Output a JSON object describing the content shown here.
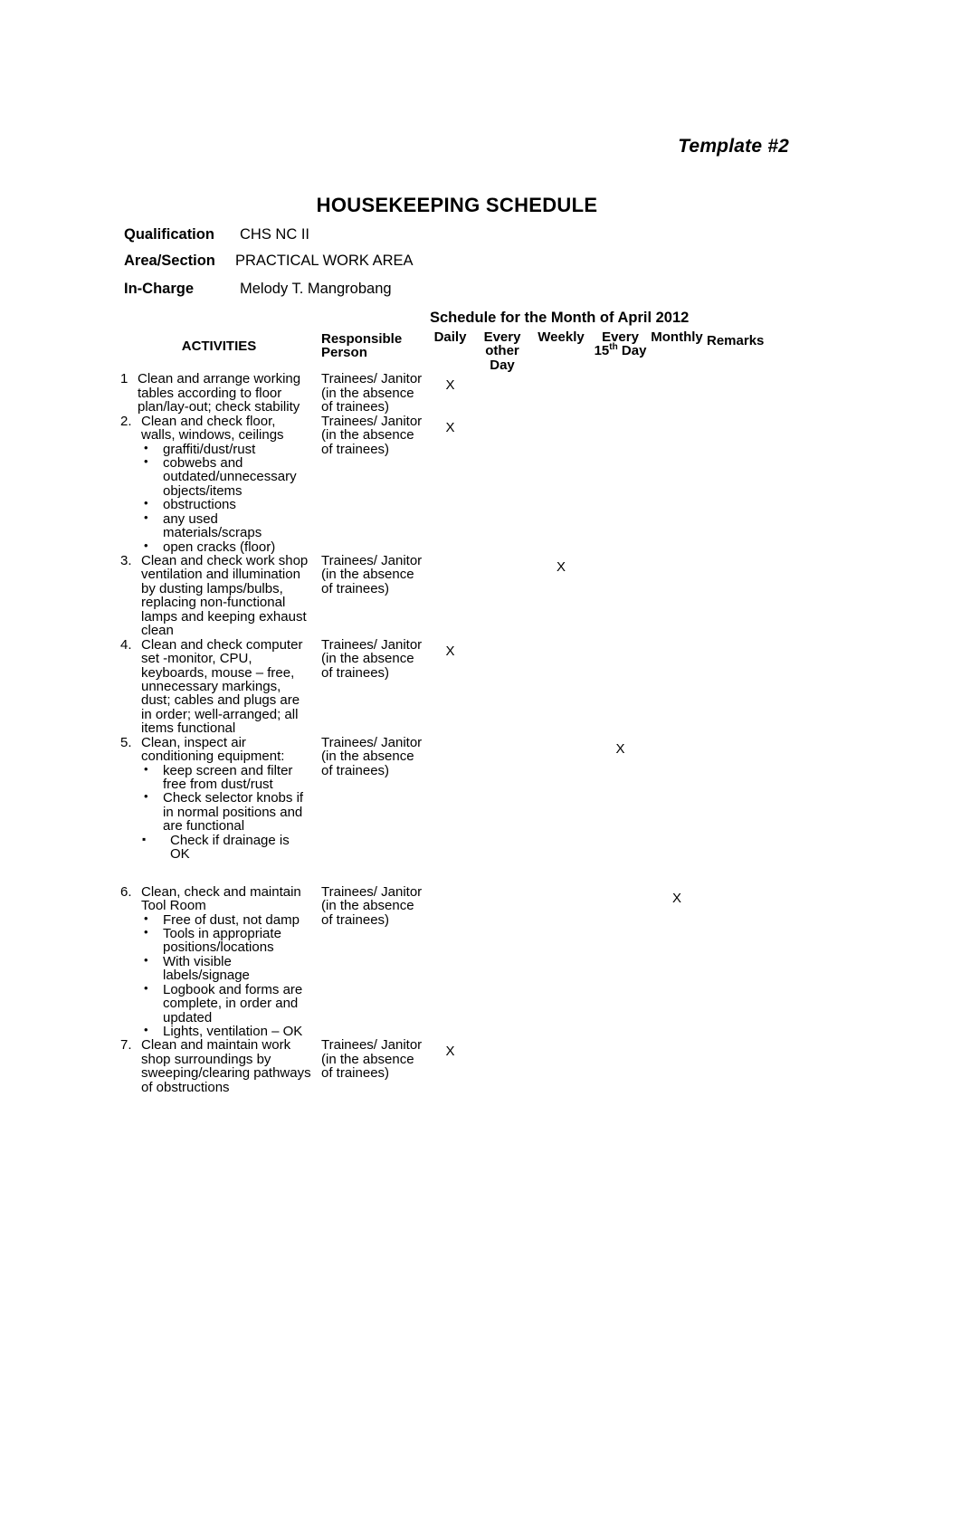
{
  "document": {
    "template_label": "Template #2",
    "title": "HOUSEKEEPING SCHEDULE",
    "schedule_for": "Schedule for the Month of April 2012"
  },
  "meta": {
    "qualification_label": "Qualification",
    "qualification_value": "CHS NC II",
    "area_label": "Area/Section",
    "area_value": "PRACTICAL WORK AREA",
    "incharge_label": "In-Charge",
    "incharge_value": "Melody T. Mangrobang"
  },
  "table": {
    "headers": {
      "activities": "ACTIVITIES",
      "responsible": "Responsible Person",
      "daily": "Daily",
      "every_other_day": "Every other Day",
      "weekly": "Weekly",
      "every_15th_day_pre": "Every 15",
      "every_15th_day_sup": "th",
      "every_15th_day_post": "Day",
      "monthly": "Monthly",
      "remarks": "Remarks"
    },
    "responsible_person_default": "Trainees/ Janitor (in the absence of trainees)",
    "mark": "X",
    "rows": [
      {
        "num": "1",
        "activity": "Clean and arrange working tables according to floor plan/lay-out; check stability",
        "subs": [],
        "responsible": "Trainees/ Janitor (in the absence of trainees)",
        "daily": "X",
        "every_other_day": "",
        "weekly": "",
        "every_15th_day": "",
        "monthly": "",
        "remarks": ""
      },
      {
        "num": "2.",
        "activity": "Clean and check floor, walls, windows, ceilings",
        "subs": [
          "graffiti/dust/rust",
          "cobwebs and outdated/unnecessary objects/items",
          "obstructions",
          "any used materials/scraps",
          "open cracks (floor)"
        ],
        "responsible": "Trainees/ Janitor (in the absence of trainees)",
        "daily": "X",
        "every_other_day": "",
        "weekly": "",
        "every_15th_day": "",
        "monthly": "",
        "remarks": ""
      },
      {
        "num": "3.",
        "activity": "Clean and check work shop ventilation and illumination by dusting lamps/bulbs, replacing non-functional lamps and keeping exhaust clean",
        "subs": [],
        "responsible": "Trainees/ Janitor (in the absence of trainees)",
        "daily": "",
        "every_other_day": "",
        "weekly": "X",
        "every_15th_day": "",
        "monthly": "",
        "remarks": ""
      },
      {
        "num": "4.",
        "activity": "Clean and check computer set -monitor, CPU, keyboards, mouse – free, unnecessary markings, dust; cables and plugs are in order; well-arranged; all items functional",
        "subs": [],
        "responsible": "Trainees/ Janitor (in the absence of trainees)",
        "daily": "X",
        "every_other_day": "",
        "weekly": "",
        "every_15th_day": "",
        "monthly": "",
        "remarks": ""
      },
      {
        "num": "5.",
        "activity": "Clean, inspect air conditioning equipment:",
        "subs": [
          "keep screen and filter free from dust/rust",
          "Check selector knobs if in normal positions and are functional"
        ],
        "subs_square": [
          "Check if drainage is OK"
        ],
        "responsible": "Trainees/ Janitor (in the absence of trainees)",
        "daily": "",
        "every_other_day": "",
        "weekly": "",
        "every_15th_day": "X",
        "monthly": "",
        "remarks": ""
      },
      {
        "num": "6.",
        "activity": "Clean, check and maintain Tool Room",
        "subs": [
          "Free of dust, not damp",
          "Tools in appropriate positions/locations",
          "With visible labels/signage",
          "Logbook and forms are complete, in order and updated",
          "Lights, ventilation – OK"
        ],
        "responsible": "Trainees/ Janitor (in the absence of trainees)",
        "daily": "",
        "every_other_day": "",
        "weekly": "",
        "every_15th_day": "",
        "monthly": "X",
        "remarks": ""
      },
      {
        "num": "7.",
        "activity": "Clean and maintain work shop surroundings by sweeping/clearing pathways of obstructions",
        "subs": [],
        "responsible": "Trainees/ Janitor (in the absence of trainees)",
        "daily": "X",
        "every_other_day": "",
        "weekly": "",
        "every_15th_day": "",
        "monthly": "",
        "remarks": ""
      }
    ]
  }
}
